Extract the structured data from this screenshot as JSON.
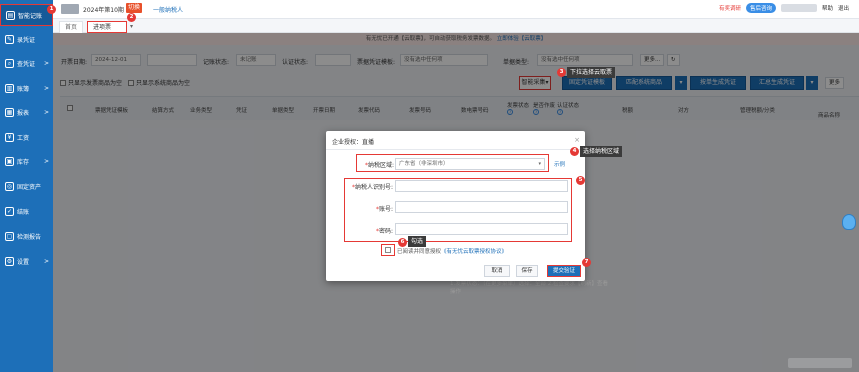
{
  "sidebar": {
    "items": [
      {
        "label": "智能记账",
        "icon": "ledger-icon",
        "arrow": ""
      },
      {
        "label": "录凭证",
        "icon": "edit-icon",
        "arrow": ""
      },
      {
        "label": "查凭证",
        "icon": "search-icon",
        "arrow": ">"
      },
      {
        "label": "账簿",
        "icon": "book-icon",
        "arrow": ">"
      },
      {
        "label": "报表",
        "icon": "report-icon",
        "arrow": ">"
      },
      {
        "label": "工资",
        "icon": "salary-icon",
        "arrow": ""
      },
      {
        "label": "库存",
        "icon": "inventory-icon",
        "arrow": ">"
      },
      {
        "label": "固定资产",
        "icon": "asset-icon",
        "arrow": ""
      },
      {
        "label": "结账",
        "icon": "check-icon",
        "arrow": ""
      },
      {
        "label": "检测报告",
        "icon": "inspect-icon",
        "arrow": ""
      },
      {
        "label": "设置",
        "icon": "gear-icon",
        "arrow": ">"
      }
    ]
  },
  "topbar": {
    "period": "2024年第10期",
    "switch_label": "切换",
    "taxpayer_type": "一般纳税人",
    "right_links": [
      "有奖调研",
      "售后咨询",
      "帮助",
      "退出"
    ]
  },
  "tabs": {
    "home": "首页",
    "active": "进项票",
    "close": "×",
    "dropdown": "▾"
  },
  "notice": {
    "text": "有无忧已开通【云取票】，可自动获取税务发票数据。",
    "link": "立即体验【云取票】"
  },
  "filters": {
    "date_label": "开票日期:",
    "date_value": "2024-12-01",
    "record_label": "记账状态:",
    "record_value": "未记账",
    "cert_label": "认证状态:",
    "template_label": "票据凭证模板:",
    "template_placeholder": "没有选中任何项",
    "type_label": "单据类型:",
    "type_placeholder": "没有选中任何项",
    "more": "更多...",
    "refresh": "↻",
    "opt1": "只显示发票商品为空",
    "opt2": "只显示系统商品为空"
  },
  "toolbar": {
    "fetch": "智能采集",
    "fetch_caret": "▾",
    "fixed_template": "固定凭证模板",
    "match_goods": "匹配系统商品",
    "gen_voucher": "按单生成凭证",
    "summary_voucher": "汇总生成凭证",
    "more": "更多"
  },
  "table_headers": [
    "票据凭证模板",
    "结算方式",
    "业务类型",
    "凭证",
    "单据类型",
    "开票日期",
    "发票代码",
    "发票号码",
    "数电票号码",
    "发票状态",
    "是否作废",
    "认证状态",
    "税额",
    "对方",
    "管理税额/分类",
    "商品名称"
  ],
  "modal": {
    "title": "企业授权：直播",
    "close": "×",
    "region_label": "纳税区域:",
    "region_value": "广东省（非深圳市）",
    "region_example": "示例",
    "taxid_label": "纳税人识别号:",
    "account_label": "账号:",
    "password_label": "密码:",
    "agree_text": "已阅读并同意授权",
    "agree_link": "《有无忧云取票授权协议》",
    "cancel": "取消",
    "save": "保存",
    "submit": "提交验证"
  },
  "annotations": {
    "b1": "1",
    "b2": "2",
    "b3": "3",
    "b4": "4",
    "b5": "5",
    "b6": "6",
    "b7": "7",
    "c3": "下拉选择云取票",
    "c4": "选择纳税区域",
    "c6": "勾选"
  },
  "behind_text": "1.发票状态：（在更多菜单）选择：全部\n2.检查要求【刷新】查看操作",
  "colors": {
    "sidebar": "#1d6fb8",
    "annotation": "#e53935",
    "primary": "#1d6fb8"
  }
}
